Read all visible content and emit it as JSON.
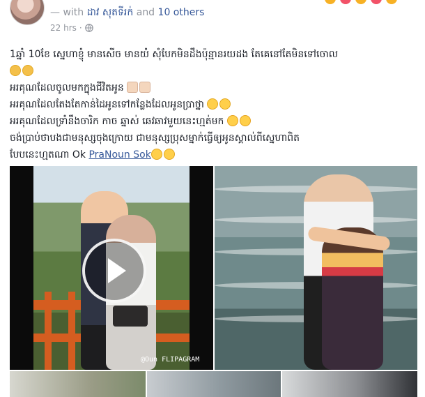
{
  "header": {
    "with_prefix": "— with",
    "tagged_user": "ដាវ សុតទីរក់",
    "and_text": "and",
    "others": "10 others",
    "time": "22 hrs",
    "separator": "·",
    "privacy_icon": "globe-icon"
  },
  "post": {
    "line1": "1ឆ្នាំ 10ខែ ស្នេហាខ្ញុំ មានសើច មានយំ សុំបែកមិនដឹងប៉ុន្មានរយដង តែគេនៅតែមិនទៅចោល",
    "line1_emoji": "sad-face-icon",
    "line2": "អរគុណដែលចូលមកក្នុងជីវិតអូន",
    "line2_emoji": "praying-hands-icon",
    "line3": "អរគុណដែលតែងតែកាន់ដៃអូនទៅកន្លែងដែលអូនប្រាថ្នា",
    "line3_emoji": "kiss-face-icon",
    "line4": "អរគុណដែលទ្រាំនឹងចារិក កាច ឆ្នាស់ ឆេវឆាវមួយនេះហ្មត់មក",
    "line4_emoji": "heart-eyes-icon",
    "line5": "ចង់ប្រាប់ថាបងជាមនុស្សចុងក្រោយ ជាមនុស្សប្រុសម្នាក់ធ្វើឲ្យអូនស្គាល់ពីស្នេហាពិត",
    "line6_prefix": "បែបនេះហ្មតណា Ok",
    "mention": "PraNoun Sok",
    "line6_emoji": "smiling-face-icon"
  },
  "media": {
    "video_watermark": "@Oun\nFLIPAGRAM",
    "play_icon": "play-icon"
  }
}
